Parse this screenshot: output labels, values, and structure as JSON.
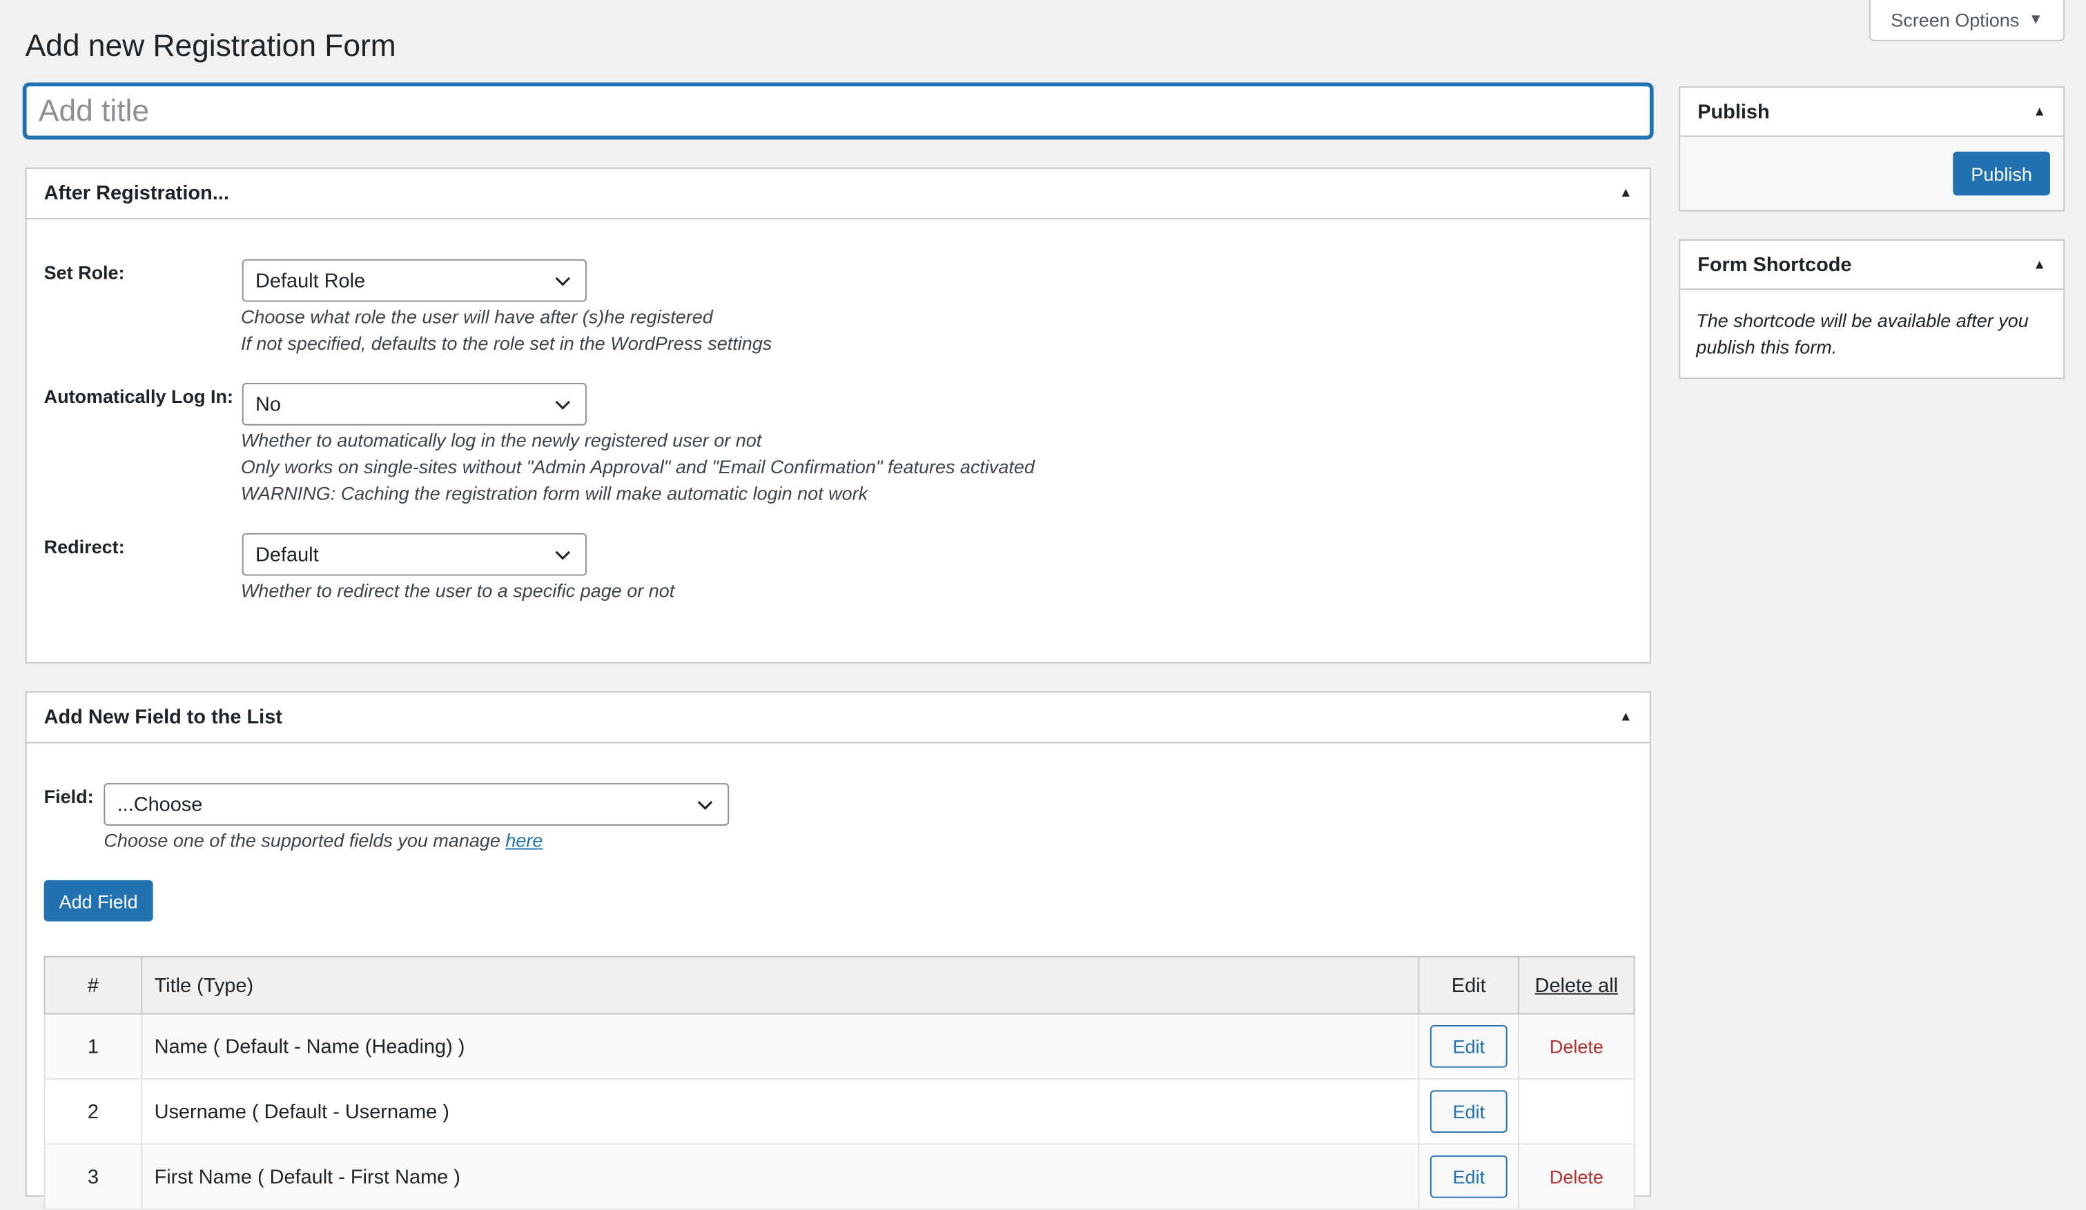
{
  "screen_options": {
    "label": "Screen Options",
    "icon": "caret-down-icon"
  },
  "page": {
    "title": "Add new Registration Form"
  },
  "title_field": {
    "placeholder": "Add title",
    "value": ""
  },
  "after_registration": {
    "heading": "After Registration...",
    "set_role": {
      "label": "Set Role:",
      "value": "Default Role",
      "desc1": "Choose what role the user will have after (s)he registered",
      "desc2": "If not specified, defaults to the role set in the WordPress settings"
    },
    "auto_login": {
      "label": "Automatically Log In:",
      "value": "No",
      "desc1": "Whether to automatically log in the newly registered user or not",
      "desc2": "Only works on single-sites without \"Admin Approval\" and \"Email Confirmation\" features activated",
      "desc3": "WARNING: Caching the registration form will make automatic login not work"
    },
    "redirect": {
      "label": "Redirect:",
      "value": "Default",
      "desc1": "Whether to redirect the user to a specific page or not"
    }
  },
  "add_field": {
    "heading": "Add New Field to the List",
    "field_label": "Field:",
    "field_value": "...Choose",
    "desc_prefix": "Choose one of the supported fields you manage ",
    "desc_link": "here",
    "button": "Add Field"
  },
  "fields_table": {
    "headers": {
      "num": "#",
      "title": "Title (Type)",
      "edit": "Edit",
      "delete_all": "Delete all"
    },
    "rows": [
      {
        "num": "1",
        "title": "Name ( Default - Name (Heading) )",
        "edit": "Edit",
        "delete": "Delete"
      },
      {
        "num": "2",
        "title": "Username ( Default - Username )",
        "edit": "Edit",
        "delete": ""
      },
      {
        "num": "3",
        "title": "First Name ( Default - First Name )",
        "edit": "Edit",
        "delete": "Delete"
      }
    ]
  },
  "publish_box": {
    "heading": "Publish",
    "button": "Publish"
  },
  "shortcode_box": {
    "heading": "Form Shortcode",
    "text": "The shortcode will be available after you publish this form."
  },
  "colors": {
    "accent": "#2271b1",
    "delete": "#b32d2e",
    "background": "#f1f1f1"
  }
}
